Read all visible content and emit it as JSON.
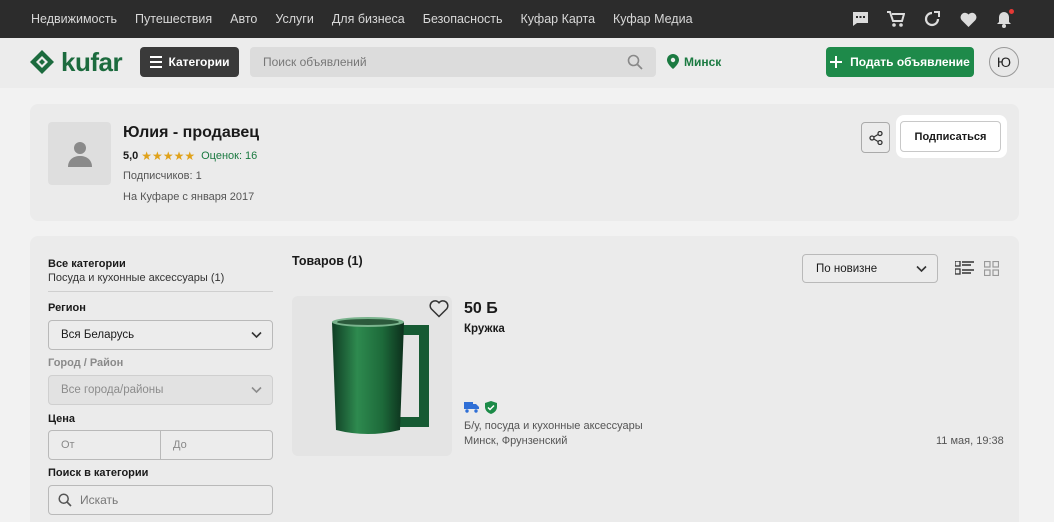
{
  "topnav": {
    "links": [
      "Недвижимость",
      "Путешествия",
      "Авто",
      "Услуги",
      "Для бизнеса",
      "Безопасность",
      "Куфар Карта",
      "Куфар Медиа"
    ],
    "icons": [
      "chat-icon",
      "cart-icon",
      "compare-icon",
      "heart-icon",
      "bell-icon"
    ]
  },
  "header": {
    "logo": "kufar",
    "categories_label": "Категории",
    "search_placeholder": "Поиск объявлений",
    "city": "Минск",
    "post_label": "Подать объявление",
    "user_initial": "Ю",
    "brand_color": "#1e8a4a"
  },
  "profile": {
    "name": "Юлия - продавец",
    "rating": "5,0",
    "stars": "★★★★★",
    "reviews": "Оценок: 16",
    "subscribers": "Подписчиков: 1",
    "since": "На Куфаре с января 2017",
    "subscribe_label": "Подписаться"
  },
  "filters": {
    "all_categories": "Все категории",
    "category_selected": "Посуда и кухонные аксессуары (1)",
    "region_label": "Регион",
    "region_value": "Вся Беларусь",
    "city_label": "Город / Район",
    "city_value": "Все города/районы",
    "price_label": "Цена",
    "price_from": "От",
    "price_to": "До",
    "search_label": "Поиск в категории",
    "search_placeholder": "Искать"
  },
  "listing": {
    "title": "Товаров (1)",
    "sort": "По новизне",
    "items": [
      {
        "price": "50 Б",
        "title": "Кружка",
        "condition": "Б/у, посуда и кухонные аксессуары",
        "location": "Минск, Фрунзенский",
        "date": "11 мая, 19:38"
      }
    ]
  }
}
